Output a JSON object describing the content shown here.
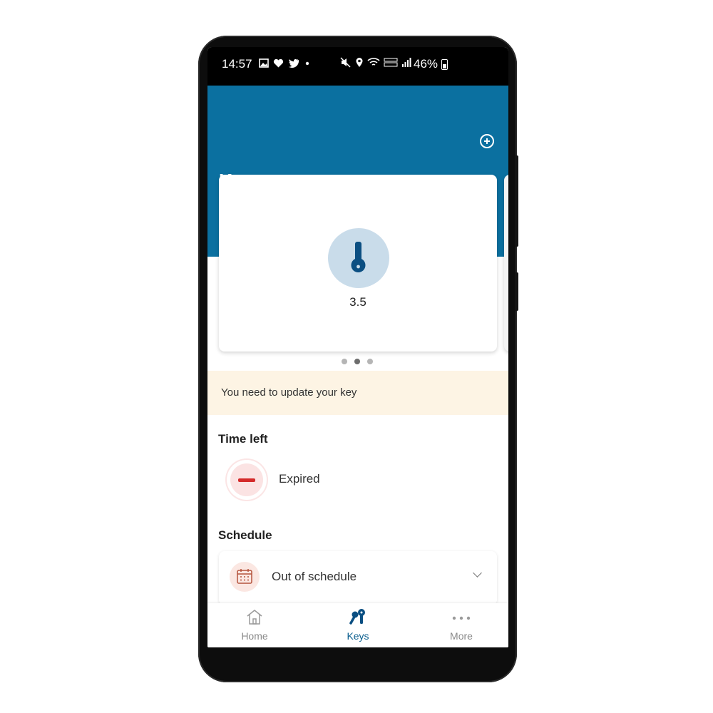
{
  "status_bar": {
    "time": "14:57",
    "battery": "46%"
  },
  "header": {
    "title": "Keys",
    "add_icon": "plus-circle-icon"
  },
  "key_card": {
    "label": "3.5",
    "icon": "key-icon"
  },
  "carousel": {
    "page_count": 3,
    "active_index": 1
  },
  "notice": {
    "text": "You need to update your key"
  },
  "time_left": {
    "title": "Time left",
    "status": "Expired",
    "icon": "minus-icon"
  },
  "schedule": {
    "title": "Schedule",
    "value": "Out of schedule",
    "icon": "calendar-icon"
  },
  "bottom_nav": {
    "items": [
      {
        "label": "Home",
        "icon": "home-icon"
      },
      {
        "label": "Keys",
        "icon": "keys-icon"
      },
      {
        "label": "More",
        "icon": "more-dots-icon"
      }
    ],
    "active_index": 1
  },
  "colors": {
    "primary": "#0b70a0",
    "nav_active": "#0b5f8f",
    "notice_bg": "#fdf4e4",
    "expired_red": "#d42a2a"
  }
}
